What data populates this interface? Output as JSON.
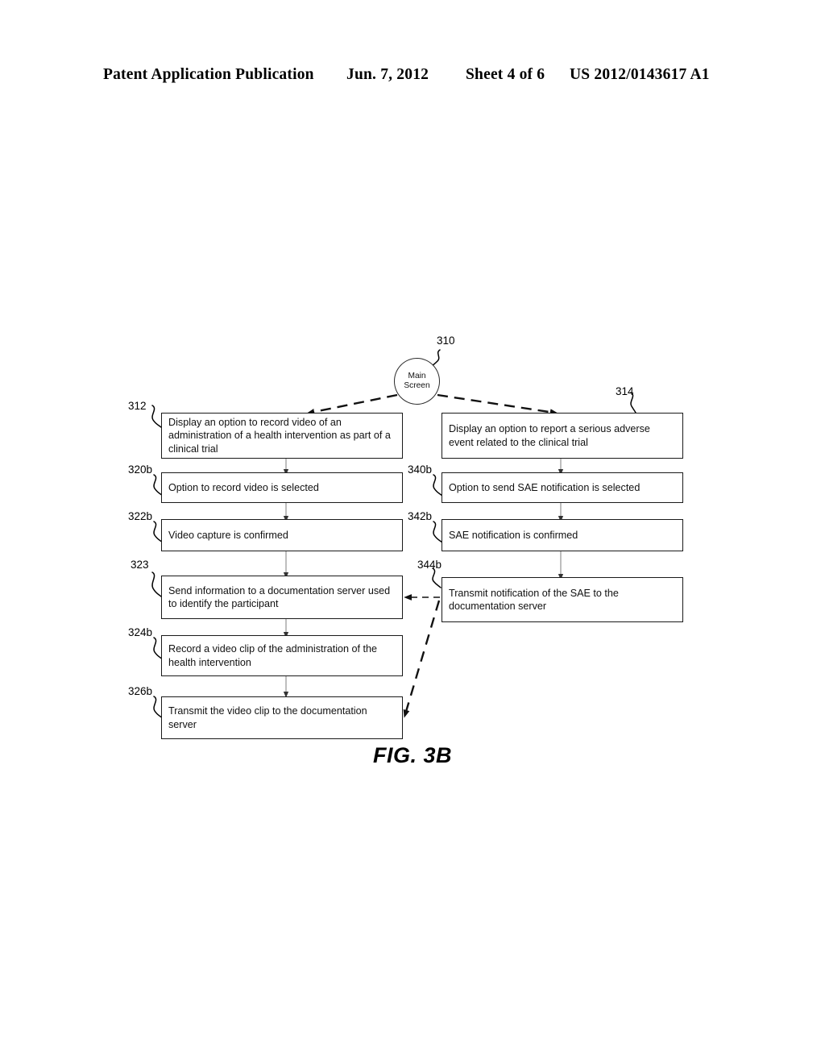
{
  "header": {
    "publication": "Patent Application Publication",
    "date": "Jun. 7, 2012",
    "sheet": "Sheet 4 of 6",
    "number": "US 2012/0143617 A1"
  },
  "figure": {
    "caption": "FIG. 3B",
    "root": {
      "ref": "310",
      "line1": "Main",
      "line2": "Screen"
    },
    "left_column": [
      {
        "ref": "312",
        "text": "Display an option to record video of an administration of a health intervention as part of a clinical trial"
      },
      {
        "ref": "320b",
        "text": "Option to record video is selected"
      },
      {
        "ref": "322b",
        "text": "Video capture is confirmed"
      },
      {
        "ref": "323",
        "text": "Send information to a documentation server used to identify the participant"
      },
      {
        "ref": "324b",
        "text": "Record a video clip of the administration of the health intervention"
      },
      {
        "ref": "326b",
        "text": "Transmit the video clip to the documentation server"
      }
    ],
    "right_column": [
      {
        "ref": "314",
        "text": "Display an option to report a serious adverse event related to the clinical trial"
      },
      {
        "ref": "340b",
        "text": "Option to send SAE notification is selected"
      },
      {
        "ref": "342b",
        "text": "SAE notification is confirmed"
      },
      {
        "ref": "344b",
        "text": "Transmit notification of the SAE to the documentation server"
      }
    ]
  },
  "colors": {
    "ink": "#000000",
    "box_border": "#1a1a1a",
    "connector": "#555555",
    "page": "#ffffff"
  }
}
